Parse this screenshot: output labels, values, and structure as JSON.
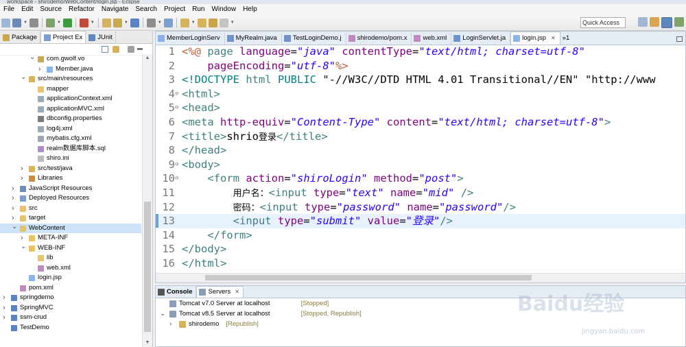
{
  "window": {
    "title": "workspace - shirodemo/WebContent/login.jsp - Eclipse"
  },
  "menu": [
    "File",
    "Edit",
    "Source",
    "Refactor",
    "Navigate",
    "Search",
    "Project",
    "Run",
    "Window",
    "Help"
  ],
  "quick_access": "Quick Access",
  "left_tabs": [
    {
      "label": "Package",
      "active": false
    },
    {
      "label": "Project Ex",
      "active": true
    },
    {
      "label": "JUnit",
      "active": false
    }
  ],
  "tree": [
    {
      "indent": 3,
      "arrow": "v",
      "icon": "package-icon",
      "color": "#c9a94d",
      "label": "com.gwolf.vo"
    },
    {
      "indent": 4,
      "arrow": ">",
      "icon": "java-file-icon",
      "color": "#8ab4e8",
      "label": "Member.java"
    },
    {
      "indent": 2,
      "arrow": "v",
      "icon": "source-folder-icon",
      "color": "#d9b35c",
      "label": "src/main/resources"
    },
    {
      "indent": 3,
      "arrow": "",
      "icon": "folder-icon",
      "color": "#e8c467",
      "label": "mapper"
    },
    {
      "indent": 3,
      "arrow": "",
      "icon": "xml-file-icon",
      "color": "#9aa8b8",
      "label": "applicationContext.xml"
    },
    {
      "indent": 3,
      "arrow": "",
      "icon": "xml-file-icon",
      "color": "#9aa8b8",
      "label": "applicationMVC.xml"
    },
    {
      "indent": 3,
      "arrow": "",
      "icon": "properties-file-icon",
      "color": "#7a7a7a",
      "label": "dbconfig.properties"
    },
    {
      "indent": 3,
      "arrow": "",
      "icon": "xml-file-icon",
      "color": "#9aa8b8",
      "label": "log4j.xml"
    },
    {
      "indent": 3,
      "arrow": "",
      "icon": "xml-file-icon",
      "color": "#9aa8b8",
      "label": "mybatis.cfg.xml"
    },
    {
      "indent": 3,
      "arrow": "",
      "icon": "sql-file-icon",
      "color": "#b08acb",
      "label": "realm数据库脚本.sql"
    },
    {
      "indent": 3,
      "arrow": "",
      "icon": "ini-file-icon",
      "color": "#bbbbbb",
      "label": "shiro.ini"
    },
    {
      "indent": 2,
      "arrow": ">",
      "icon": "source-folder-icon",
      "color": "#d9b35c",
      "label": "src/test/java"
    },
    {
      "indent": 2,
      "arrow": ">",
      "icon": "libraries-icon",
      "color": "#c98f4a",
      "label": "Libraries"
    },
    {
      "indent": 1,
      "arrow": ">",
      "icon": "js-resources-icon",
      "color": "#6c8ebf",
      "label": "JavaScript Resources"
    },
    {
      "indent": 1,
      "arrow": ">",
      "icon": "deployed-resources-icon",
      "color": "#7a9fd0",
      "label": "Deployed Resources"
    },
    {
      "indent": 1,
      "arrow": ">",
      "icon": "folder-icon",
      "color": "#e8c467",
      "label": "src"
    },
    {
      "indent": 1,
      "arrow": ">",
      "icon": "folder-icon",
      "color": "#e8c467",
      "label": "target"
    },
    {
      "indent": 1,
      "arrow": "v",
      "icon": "folder-icon",
      "color": "#e8c467",
      "label": "WebContent",
      "selected": true
    },
    {
      "indent": 2,
      "arrow": ">",
      "icon": "folder-icon",
      "color": "#e8c467",
      "label": "META-INF"
    },
    {
      "indent": 2,
      "arrow": "v",
      "icon": "folder-icon",
      "color": "#e8c467",
      "label": "WEB-INF"
    },
    {
      "indent": 3,
      "arrow": "",
      "icon": "folder-icon",
      "color": "#e8c467",
      "label": "lib"
    },
    {
      "indent": 3,
      "arrow": "",
      "icon": "xml-file-icon",
      "color": "#c08ac0",
      "label": "web.xml"
    },
    {
      "indent": 2,
      "arrow": "",
      "icon": "jsp-file-icon",
      "color": "#8ab4e8",
      "label": "login.jsp"
    },
    {
      "indent": 1,
      "arrow": "",
      "icon": "xml-file-icon",
      "color": "#c08ac0",
      "label": "pom.xml"
    },
    {
      "indent": 0,
      "arrow": ">",
      "icon": "project-icon",
      "color": "#5b83c4",
      "label": "springdemo"
    },
    {
      "indent": 0,
      "arrow": ">",
      "icon": "project-icon",
      "color": "#5b83c4",
      "label": "SpringMVC"
    },
    {
      "indent": 0,
      "arrow": ">",
      "icon": "project-icon",
      "color": "#5b83c4",
      "label": "ssm-crud"
    },
    {
      "indent": 0,
      "arrow": "",
      "icon": "project-icon",
      "color": "#5b83c4",
      "label": "TestDemo"
    }
  ],
  "editor_tabs": [
    {
      "label": "MemberLoginServ",
      "icon": "jsp-file-icon",
      "active": false
    },
    {
      "label": "MyRealm.java",
      "icon": "java-file-icon",
      "active": false
    },
    {
      "label": "TestLoginDemo.j",
      "icon": "java-file-icon",
      "active": false
    },
    {
      "label": "shirodemo/pom.x",
      "icon": "xml-file-icon",
      "active": false
    },
    {
      "label": "web.xml",
      "icon": "xml-file-icon",
      "active": false
    },
    {
      "label": "LoginServlet.ja",
      "icon": "java-file-icon",
      "active": false
    },
    {
      "label": "login.jsp",
      "icon": "jsp-file-icon",
      "active": true,
      "close": "✕"
    }
  ],
  "editor_overflow": "»1",
  "code_lines": [
    {
      "n": "1",
      "fold": "",
      "tokens": [
        [
          "dir",
          "<%@ "
        ],
        [
          "kw",
          "page "
        ],
        [
          "at",
          "language"
        ],
        [
          "pl",
          "="
        ],
        [
          "st",
          "\"java\""
        ],
        [
          "pl",
          " "
        ],
        [
          "at",
          "contentType"
        ],
        [
          "pl",
          "="
        ],
        [
          "st",
          "\"text/html; charset=utf-8\""
        ]
      ]
    },
    {
      "n": "2",
      "fold": "",
      "tokens": [
        [
          "pl",
          "    "
        ],
        [
          "at",
          "pageEncoding"
        ],
        [
          "pl",
          "="
        ],
        [
          "st",
          "\"utf-8\""
        ],
        [
          "dir",
          "%>"
        ]
      ]
    },
    {
      "n": "3",
      "fold": "",
      "tokens": [
        [
          "dt",
          "<!DOCTYPE "
        ],
        [
          "kw",
          "html "
        ],
        [
          "dt",
          "PUBLIC "
        ],
        [
          "st2",
          "\"-//W3C//DTD HTML 4.01 Transitional//EN\""
        ],
        [
          "pl",
          " "
        ],
        [
          "st2",
          "\"http://www"
        ]
      ]
    },
    {
      "n": "4",
      "fold": "⊖",
      "tokens": [
        [
          "kw",
          "<html>"
        ]
      ]
    },
    {
      "n": "5",
      "fold": "⊖",
      "tokens": [
        [
          "kw",
          "<head>"
        ]
      ]
    },
    {
      "n": "6",
      "fold": "",
      "tokens": [
        [
          "kw",
          "<meta "
        ],
        [
          "at",
          "http-equiv"
        ],
        [
          "pl",
          "="
        ],
        [
          "st",
          "\"Content-Type\""
        ],
        [
          "pl",
          " "
        ],
        [
          "at",
          "content"
        ],
        [
          "pl",
          "="
        ],
        [
          "st",
          "\"text/html; charset=utf-8\""
        ],
        [
          "kw",
          ">"
        ]
      ]
    },
    {
      "n": "7",
      "fold": "",
      "tokens": [
        [
          "kw",
          "<title>"
        ],
        [
          "pl",
          "shrio"
        ],
        [
          "tx",
          "登录"
        ],
        [
          "kw",
          "</title>"
        ]
      ]
    },
    {
      "n": "8",
      "fold": "",
      "tokens": [
        [
          "kw",
          "</head>"
        ]
      ]
    },
    {
      "n": "9",
      "fold": "⊖",
      "tokens": [
        [
          "kw",
          "<body>"
        ]
      ]
    },
    {
      "n": "10",
      "fold": "⊖",
      "tokens": [
        [
          "pl",
          "    "
        ],
        [
          "kw",
          "<form "
        ],
        [
          "at",
          "action"
        ],
        [
          "pl",
          "="
        ],
        [
          "st",
          "\"shiroLogin\""
        ],
        [
          "pl",
          " "
        ],
        [
          "at",
          "method"
        ],
        [
          "pl",
          "="
        ],
        [
          "st",
          "\"post\""
        ],
        [
          "kw",
          ">"
        ]
      ]
    },
    {
      "n": "11",
      "fold": "",
      "tokens": [
        [
          "pl",
          "        "
        ],
        [
          "tx",
          "用户名："
        ],
        [
          "kw",
          "<input "
        ],
        [
          "at",
          "type"
        ],
        [
          "pl",
          "="
        ],
        [
          "st",
          "\"text\""
        ],
        [
          "pl",
          " "
        ],
        [
          "at",
          "name"
        ],
        [
          "pl",
          "="
        ],
        [
          "st",
          "\"mid\""
        ],
        [
          "pl",
          " "
        ],
        [
          "kw",
          "/>"
        ]
      ]
    },
    {
      "n": "12",
      "fold": "",
      "tokens": [
        [
          "pl",
          "        "
        ],
        [
          "tx",
          "密码："
        ],
        [
          "kw",
          "<input "
        ],
        [
          "at",
          "type"
        ],
        [
          "pl",
          "="
        ],
        [
          "st",
          "\"password\""
        ],
        [
          "pl",
          " "
        ],
        [
          "at",
          "name"
        ],
        [
          "pl",
          "="
        ],
        [
          "st",
          "\"password\""
        ],
        [
          "kw",
          "/>"
        ]
      ]
    },
    {
      "n": "13",
      "fold": "",
      "current": true,
      "tokens": [
        [
          "pl",
          "        "
        ],
        [
          "kw",
          "<input "
        ],
        [
          "at",
          "type"
        ],
        [
          "pl",
          "="
        ],
        [
          "st",
          "\"submit\""
        ],
        [
          "pl",
          " "
        ],
        [
          "at",
          "value"
        ],
        [
          "pl",
          "="
        ],
        [
          "st",
          "\"登录\""
        ],
        [
          "kw",
          "/>"
        ]
      ]
    },
    {
      "n": "14",
      "fold": "",
      "tokens": [
        [
          "pl",
          "    "
        ],
        [
          "kw",
          "</form>"
        ]
      ]
    },
    {
      "n": "15",
      "fold": "",
      "tokens": [
        [
          "kw",
          "</body>"
        ]
      ]
    },
    {
      "n": "16",
      "fold": "",
      "tokens": [
        [
          "kw",
          "</html>"
        ]
      ]
    }
  ],
  "bottom_tabs": [
    {
      "label": "Console",
      "active": false
    },
    {
      "label": "Servers",
      "active": true,
      "close": "✕"
    }
  ],
  "servers": [
    {
      "arrow": "",
      "label": "Tomcat v7.0 Server at localhost",
      "status": "[Stopped]",
      "indent": 0
    },
    {
      "arrow": "v",
      "label": "Tomcat v8.5 Server at localhost",
      "status": "[Stopped, Republish]",
      "indent": 0
    },
    {
      "arrow": ">",
      "label": "shirodemo",
      "status": "[Republish]",
      "indent": 1
    }
  ],
  "watermark": {
    "text": "Baidu经验",
    "url": "jingyan.baidu.com"
  }
}
